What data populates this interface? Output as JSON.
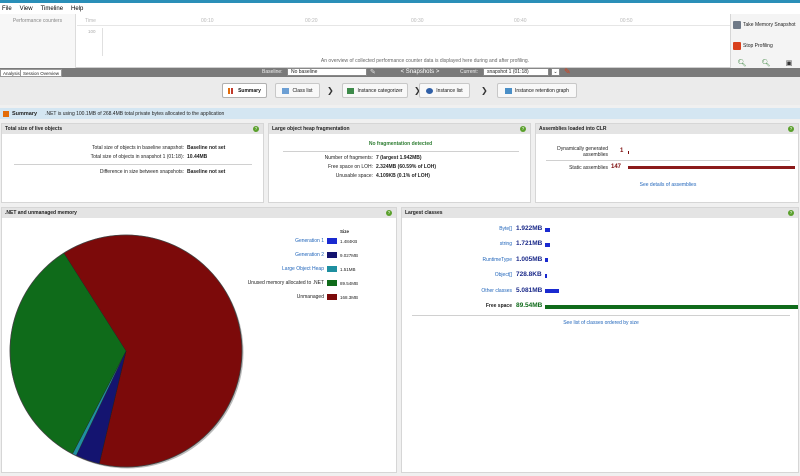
{
  "menu": [
    "File",
    "View",
    "Timeline",
    "Help"
  ],
  "timeline": {
    "perf_label": "Performance counters",
    "ticks": [
      "Time",
      "00:10",
      "00:20",
      "00:30",
      "00:40",
      "00:50"
    ],
    "scale_top": "100",
    "overview_text": "An overview of collected performance counter data is displayed here during and after profiling."
  },
  "right_panel": {
    "take_snapshot": "Take Memory Snapshot",
    "stop_profiling": "Stop Profiling",
    "colors": {
      "snapshot": "#6f7a88",
      "stop": "#d9401c"
    }
  },
  "tabs": {
    "analysis": "Analysis",
    "session_overview": "Session Overview"
  },
  "snapshot_bar": {
    "baseline_label": "Baseline:",
    "baseline_value": "No baseline",
    "snapshots_label": "< Snapshots >",
    "current_label": "Current:",
    "current_value": "snapshot 1 (01:18)"
  },
  "nav": {
    "summary": "Summary",
    "class_list": "Class list",
    "instance_categorizer": "Instance categorizer",
    "instance_list": "Instance list",
    "instance_retention_graph": "Instance retention graph"
  },
  "summary_strip": {
    "title": "Summary",
    "text": ".NET is using 100.1MB of 268.4MB total private bytes allocated to the application"
  },
  "live_objects": {
    "title": "Total size of live objects",
    "baseline_label": "Total size of objects in baseline snapshot:",
    "baseline_value": "Baseline not set",
    "snapshot_label": "Total size of objects in snapshot 1 (01:18):",
    "snapshot_value": "10.44MB",
    "diff_label": "Difference in size between snapshots:",
    "diff_value": "Baseline not set"
  },
  "loh": {
    "title": "Large object heap fragmentation",
    "status": "No fragmentation detected",
    "fragments_label": "Number of fragments:",
    "fragments_value": "7 (largest 1.942MB)",
    "free_label": "Free space on LOH:",
    "free_value": "2.324MB (60.59% of LOH)",
    "unusable_label": "Unusable space:",
    "unusable_value": "4.109KB (0.1% of LOH)"
  },
  "assemblies": {
    "title": "Assemblies loaded into CLR",
    "dynamic_label": "Dynamically generated assemblies",
    "dynamic_value": "1",
    "static_label": "Static assemblies",
    "static_value": "147",
    "link": "See details of assemblies"
  },
  "memory": {
    "title": ".NET and unmanaged memory",
    "size_header": "Size",
    "legend": [
      {
        "label": "Generation 1",
        "value": "1.484KB",
        "color": "#1a2ad0",
        "link": true
      },
      {
        "label": "Generation 2",
        "value": "9.027MB",
        "color": "#141470",
        "link": true
      },
      {
        "label": "Large Object Heap",
        "value": "1.51MB",
        "color": "#1e8fa0",
        "link": true
      },
      {
        "label": "Unused memory allocated to .NET",
        "value": "89.54MB",
        "color": "#0f6b1a",
        "link": false
      },
      {
        "label": "Unmanaged",
        "value": "168.3MB",
        "color": "#7c0a0a",
        "link": false
      }
    ],
    "pie_values_mb": [
      0.00145,
      9.027,
      1.51,
      89.54,
      168.3
    ]
  },
  "largest_classes": {
    "title": "Largest classes",
    "items": [
      {
        "name": "Byte[]",
        "value": "1.922MB",
        "mb": 1.922,
        "link": true,
        "color": "#1a2ad0"
      },
      {
        "name": "string",
        "value": "1.721MB",
        "mb": 1.721,
        "link": true,
        "color": "#1a2ad0"
      },
      {
        "name": "RuntimeType",
        "value": "1.005MB",
        "mb": 1.005,
        "link": true,
        "color": "#1a2ad0"
      },
      {
        "name": "Object[]",
        "value": "728.8KB",
        "mb": 0.7288,
        "link": true,
        "color": "#1a2ad0"
      },
      {
        "name": "Other classes",
        "value": "5.081MB",
        "mb": 5.081,
        "link": true,
        "color": "#1a2ad0"
      },
      {
        "name": "Free space",
        "value": "89.54MB",
        "mb": 89.54,
        "link": false,
        "color": "#0f6b1a"
      }
    ],
    "link": "See list of classes ordered by size"
  }
}
